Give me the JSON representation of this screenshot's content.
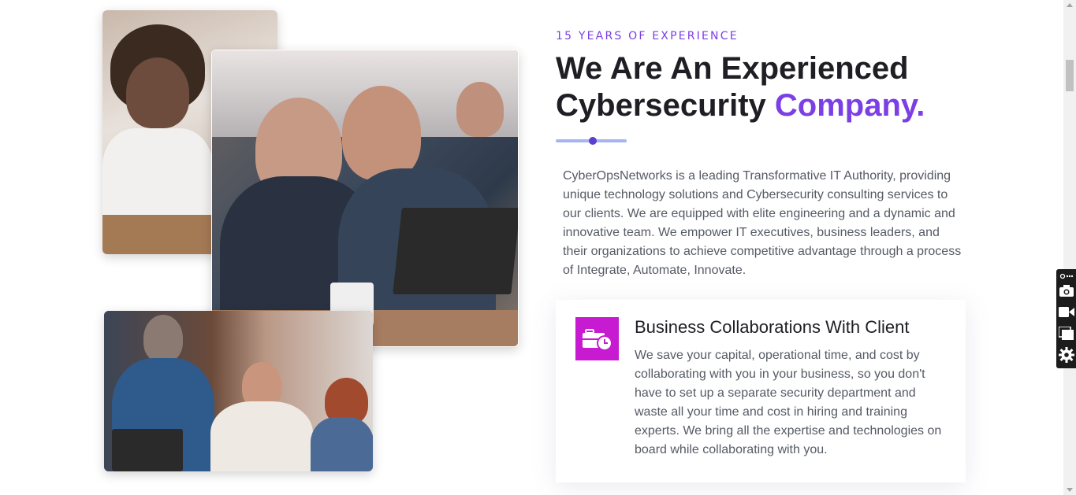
{
  "about": {
    "eyebrow": "15 YEARS OF EXPERIENCE",
    "headline_main": "We Are An Experienced Cybersecurity ",
    "headline_accent": "Company.",
    "intro": "CyberOpsNetworks is a leading Transformative IT Authority, providing unique technology solutions and Cybersecurity consulting services to our clients. We are equipped with elite engineering and a dynamic and innovative team. We empower IT executives, business leaders, and their organizations to achieve competitive advantage through a process of Integrate, Automate, Innovate."
  },
  "feature": {
    "icon": "briefcase-clock-icon",
    "title": "Business Collaborations With Client",
    "text": "We save your capital, operational time, and cost by collaborating with you in your business, so you don't have to set up a separate security department and waste all your time and cost in hiring and training experts. We bring all the expertise and technologies on board while collaborating with you."
  },
  "tools": [
    "link-icon",
    "camera-icon",
    "video-icon",
    "copy-icon",
    "settings-icon"
  ],
  "colors": {
    "accent": "#7b3fe4",
    "icon_bg": "#c61bd1",
    "divider": "#a8b4f0"
  }
}
